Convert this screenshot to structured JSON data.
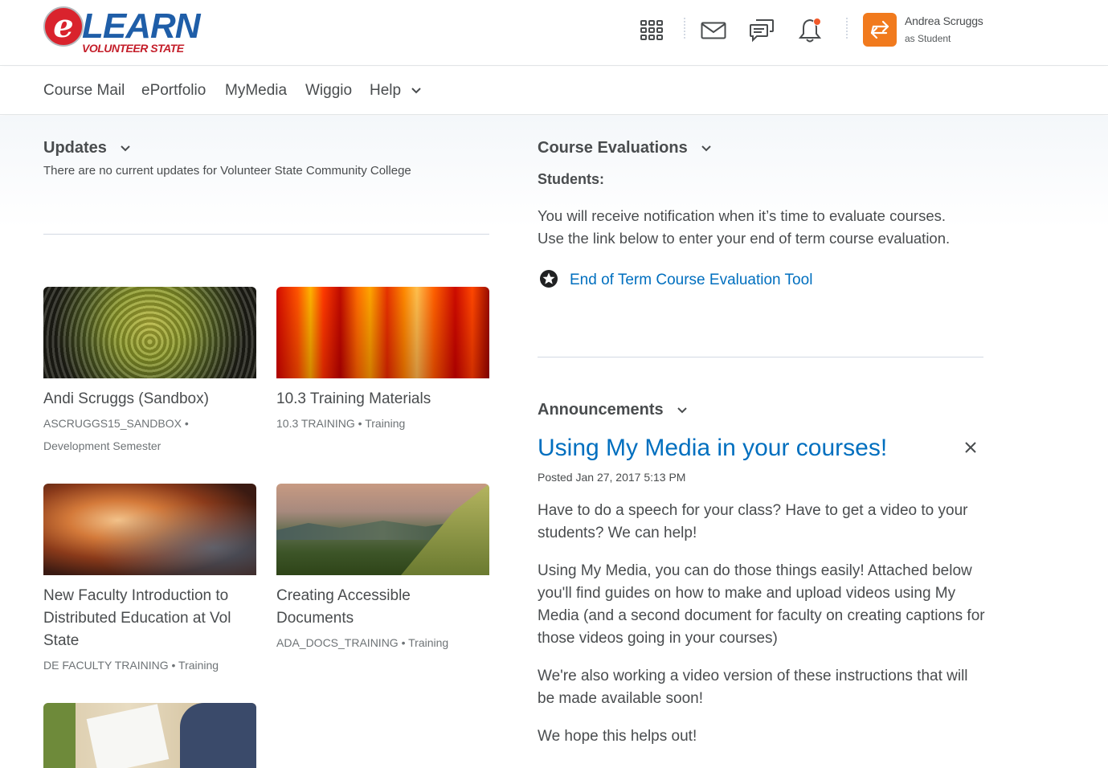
{
  "header": {
    "logo_word": "LEARN",
    "logo_letter": "e",
    "logo_sub": "VOLUNTEER STATE",
    "user_name": "Andrea Scruggs",
    "user_role": "as Student",
    "icons": [
      "grid-icon",
      "mail-icon",
      "chat-icon",
      "bell-icon",
      "switch-user-icon"
    ]
  },
  "nav": {
    "items": [
      "Course Mail",
      "ePortfolio",
      "MyMedia",
      "Wiggio",
      "Help"
    ]
  },
  "updates": {
    "title": "Updates",
    "message": "There are no current updates for Volunteer State Community College"
  },
  "courses": [
    {
      "title": "Andi Scruggs (Sandbox)",
      "code": "ASCRUGGS15_SANDBOX",
      "semester": "Development Semester"
    },
    {
      "title": "10.3 Training Materials",
      "code": "10.3 TRAINING",
      "semester": "Training"
    },
    {
      "title": "New Faculty Introduction to Distributed Education at Vol State",
      "code": "DE FACULTY TRAINING",
      "semester": "Training"
    },
    {
      "title": "Creating Accessible Documents",
      "code": "ADA_DOCS_TRAINING",
      "semester": "Training"
    }
  ],
  "evaluations": {
    "title": "Course Evaluations",
    "subtitle": "Students:",
    "line1": "You will receive notification when it’s time to evaluate courses.",
    "line2": "Use the link below to enter your end of term course evaluation.",
    "link": "End of Term Course Evaluation Tool"
  },
  "announcements": {
    "title": "Announcements",
    "headline": "Using My Media in your courses!",
    "posted": "Posted Jan 27, 2017 5:13 PM",
    "p1": "Have to do a speech for your class? Have to get a video to your students? We can help!",
    "p2": "Using My Media, you can do those things easily! Attached below you'll find guides on how to make and upload videos using My Media (and a second document for faculty on creating captions for those videos going in your courses)",
    "p3": "We're also working a video version of these instructions that will be made available soon!",
    "p4": "We hope this helps out!"
  },
  "colors": {
    "accent": "#006fbf",
    "user_avatar": "#f17a1d",
    "notification": "#f1592a",
    "text": "#494c4e"
  }
}
